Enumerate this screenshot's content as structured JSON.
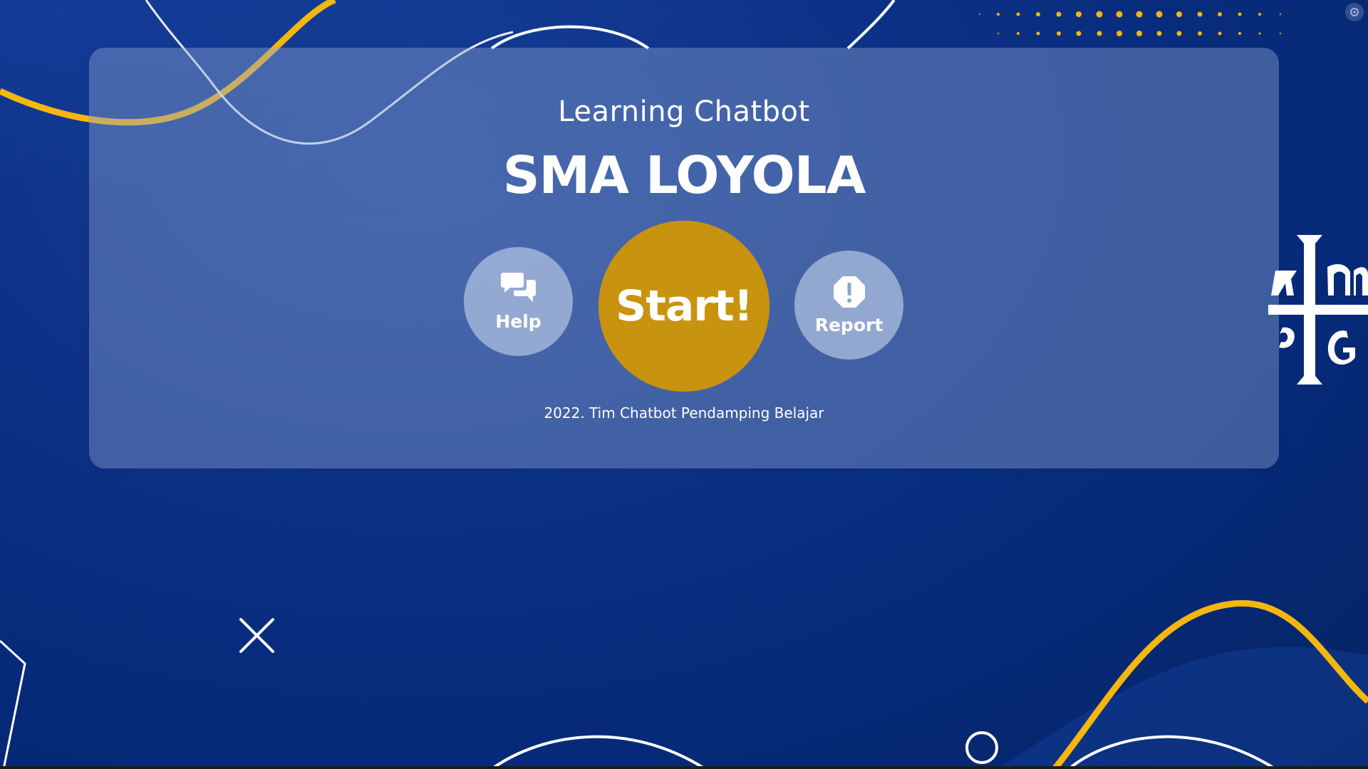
{
  "app": {
    "subtitle": "Learning Chatbot",
    "title": "SMA LOYOLA",
    "credit": "2022. Tim Chatbot Pendamping Belajar"
  },
  "buttons": {
    "help": {
      "label": "Help",
      "icon": "chat-bubbles-icon"
    },
    "start": {
      "label": "Start!"
    },
    "report": {
      "label": "Report",
      "icon": "alert-octagon-icon"
    }
  },
  "colors": {
    "background": "#0a2f80",
    "accent_gold": "#c8930f",
    "wave_gold": "#f5b60f",
    "card": "rgba(140,165,210,0.42)",
    "text": "#ffffff"
  }
}
